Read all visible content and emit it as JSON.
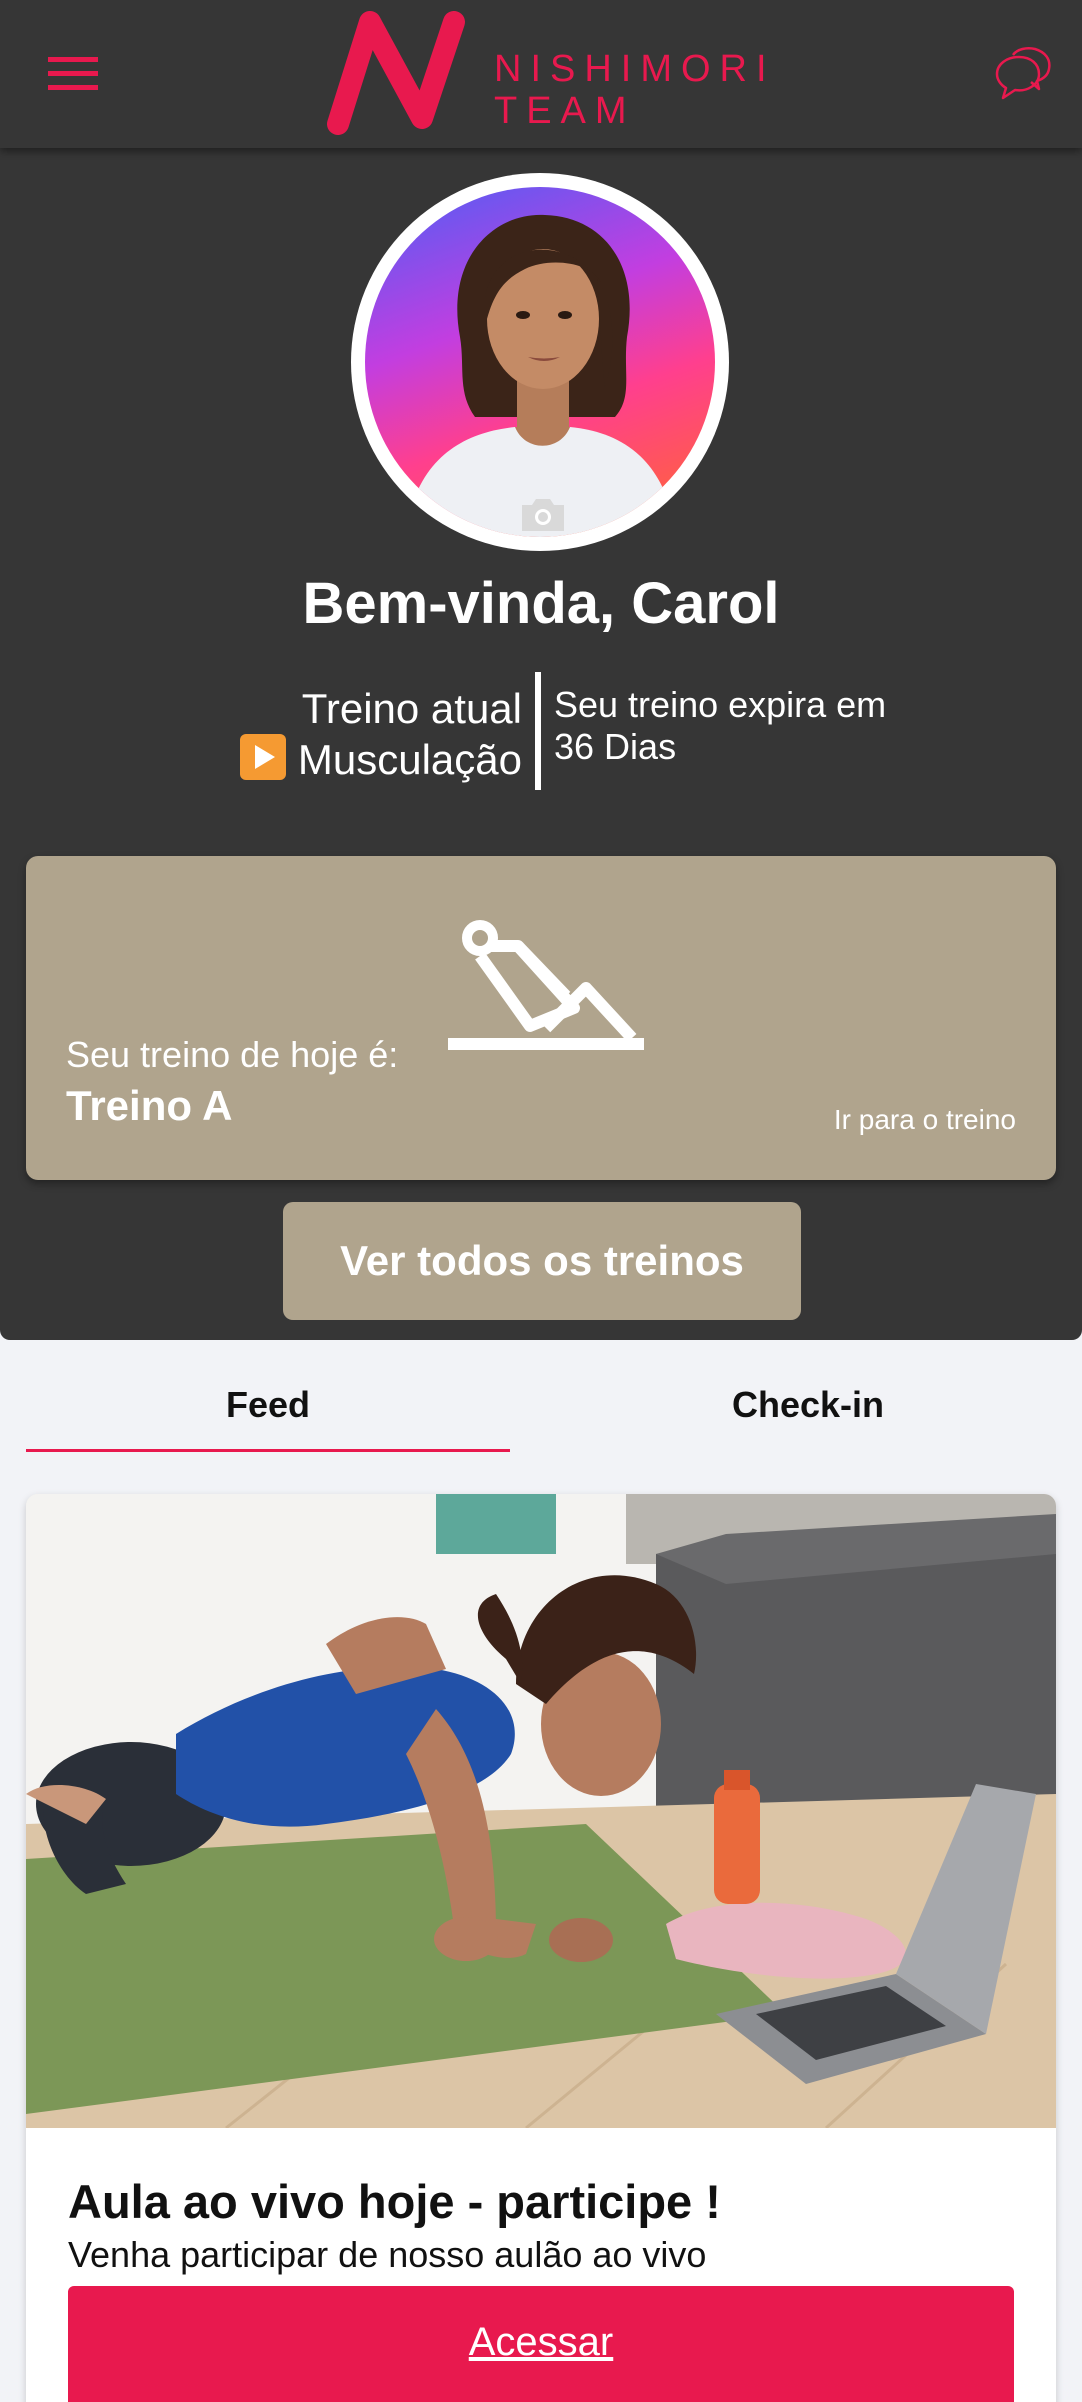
{
  "header": {
    "brand_line1": "NISHIMORI",
    "brand_line2": "TEAM",
    "accent_color": "#e8194e",
    "menu_icon": "hamburger-menu-icon",
    "chat_icon": "chat-bubbles-icon"
  },
  "profile": {
    "welcome": "Bem-vinda, Carol",
    "avatar_icon": "camera-icon"
  },
  "plan": {
    "current_label": "Treino atual",
    "current_value": "Musculação",
    "expire_label": "Seu treino expira em",
    "expire_value": "36 Dias"
  },
  "today": {
    "label": "Seu treino de hoje é:",
    "name": "Treino A",
    "link": "Ir para o treino",
    "icon": "exercise-machine-icon",
    "card_color": "#b0a48d"
  },
  "all_workouts_label": "Ver todos os treinos",
  "tabs": [
    {
      "label": "Feed",
      "active": true
    },
    {
      "label": "Check-in",
      "active": false
    }
  ],
  "feed": {
    "items": [
      {
        "title": "Aula ao vivo hoje - participe !",
        "description": "Venha participar de nosso aulão ao vivo",
        "button": "Acessar"
      }
    ]
  }
}
